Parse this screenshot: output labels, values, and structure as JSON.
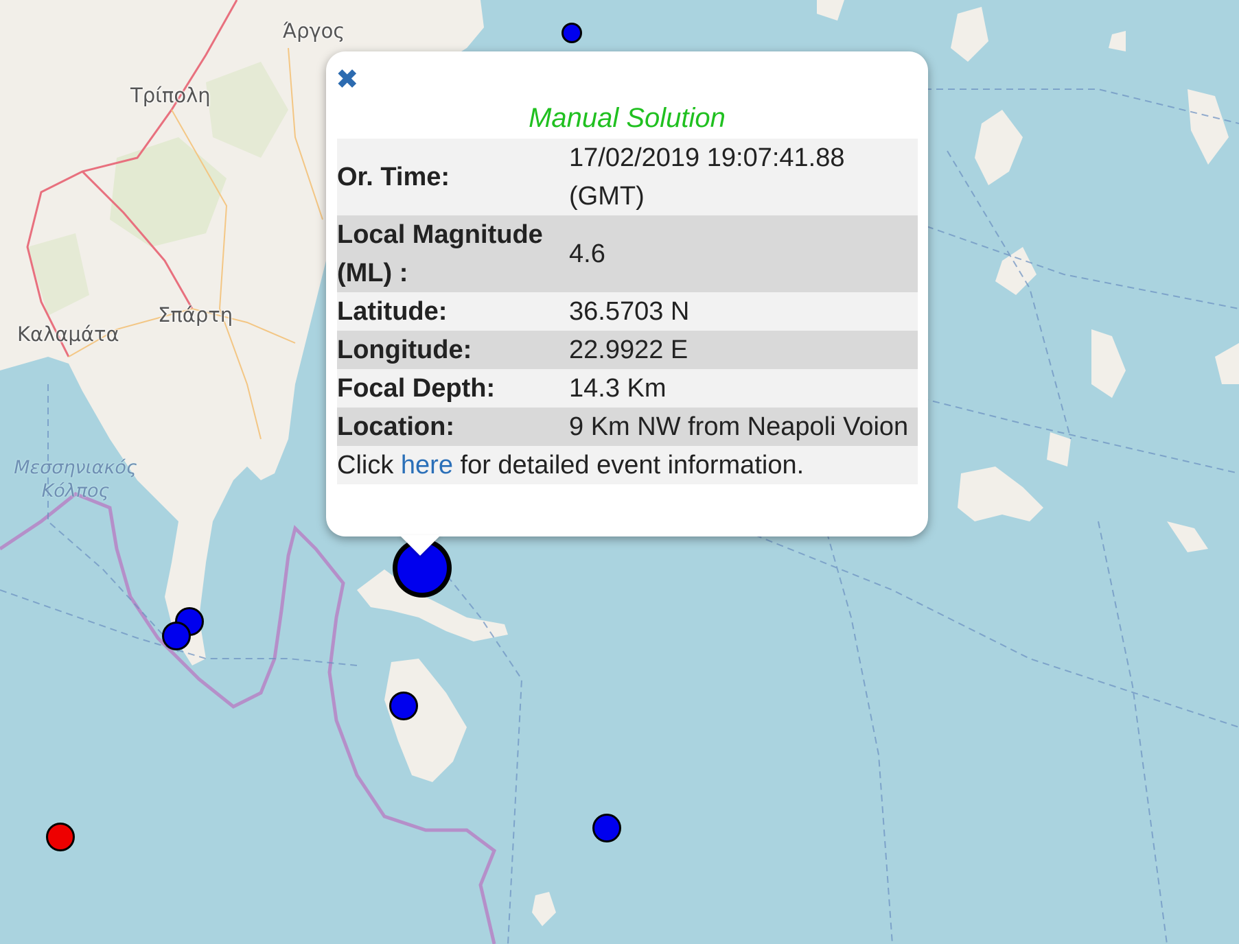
{
  "map": {
    "places": [
      {
        "name": "Άργος"
      },
      {
        "name": "Τρίπολη"
      },
      {
        "name": "Σπάρτη"
      },
      {
        "name": "Καλαμάτα"
      }
    ],
    "gulf_label": [
      "Μεσσηνιακός",
      "Κόλπος"
    ],
    "colors": {
      "sea": "#aad3df",
      "land": "#f2efe9",
      "border": "#b58fc9",
      "road": "#e8707e",
      "marker_blue": "#0000ee",
      "marker_red": "#ee0000"
    }
  },
  "markers": [
    {
      "name": "event-marker-selected",
      "color": "blue",
      "selected": true
    },
    {
      "name": "event-marker",
      "color": "blue"
    },
    {
      "name": "event-marker",
      "color": "blue"
    },
    {
      "name": "event-marker",
      "color": "blue"
    },
    {
      "name": "event-marker",
      "color": "blue"
    },
    {
      "name": "event-marker",
      "color": "blue"
    },
    {
      "name": "event-marker",
      "color": "red"
    }
  ],
  "popup": {
    "close_icon": "close-icon",
    "title": "Manual Solution",
    "rows": [
      {
        "label": "Or. Time:",
        "value": "17/02/2019 19:07:41.88 (GMT)"
      },
      {
        "label": "Local Magnitude (ML) :",
        "value": "4.6"
      },
      {
        "label": "Latitude:",
        "value": "36.5703 N"
      },
      {
        "label": "Longitude:",
        "value": "22.9922 E"
      },
      {
        "label": "Focal Depth:",
        "value": "14.3 Km"
      },
      {
        "label": "Location:",
        "value": "9 Km NW from Neapoli Voion"
      }
    ],
    "footer": {
      "prefix": "Click",
      "link": "here",
      "suffix": "for detailed event information."
    }
  }
}
